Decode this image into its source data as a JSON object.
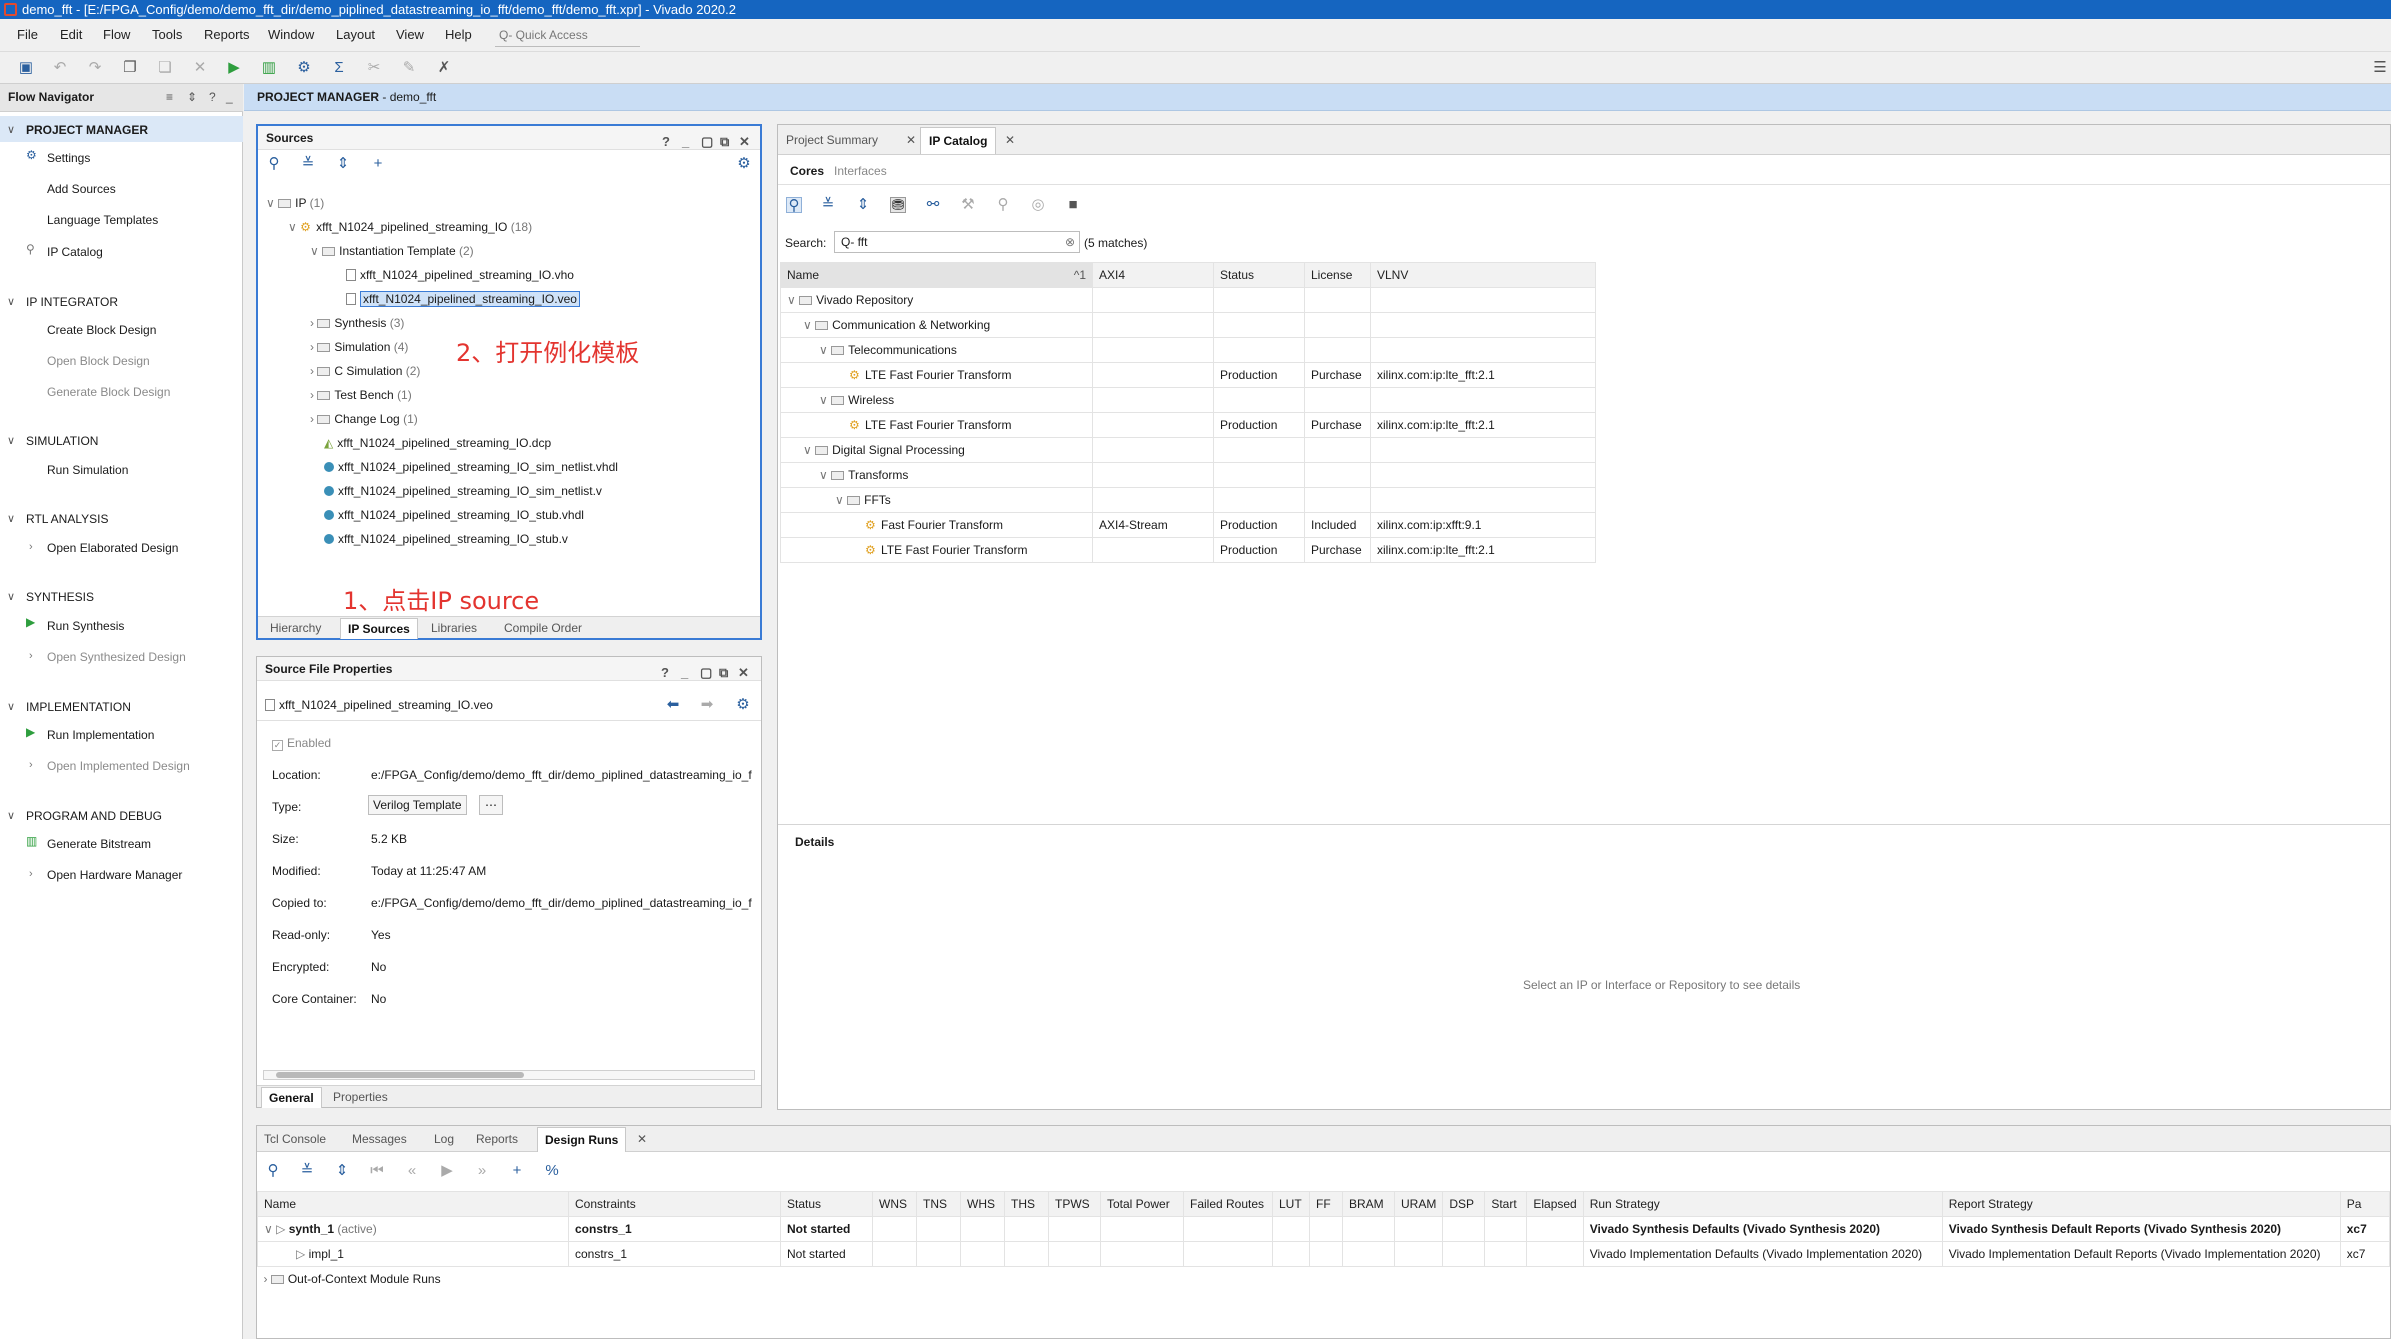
{
  "window": {
    "title": "demo_fft - [E:/FPGA_Config/demo/demo_fft_dir/demo_piplined_datastreaming_io_fft/demo_fft/demo_fft.xpr] - Vivado 2020.2"
  },
  "menu": [
    "File",
    "Edit",
    "Flow",
    "Tools",
    "Reports",
    "Window",
    "Layout",
    "View",
    "Help"
  ],
  "quick_access": "Q- Quick Access",
  "flow_navigator": {
    "title": "Flow Navigator",
    "sections": [
      {
        "label": "PROJECT MANAGER",
        "items": [
          "Settings",
          "Add Sources",
          "Language Templates",
          "IP Catalog"
        ]
      },
      {
        "label": "IP INTEGRATOR",
        "items": [
          "Create Block Design",
          "Open Block Design",
          "Generate Block Design"
        ]
      },
      {
        "label": "SIMULATION",
        "items": [
          "Run Simulation"
        ]
      },
      {
        "label": "RTL ANALYSIS",
        "items": [
          "Open Elaborated Design"
        ]
      },
      {
        "label": "SYNTHESIS",
        "items": [
          "Run Synthesis",
          "Open Synthesized Design"
        ]
      },
      {
        "label": "IMPLEMENTATION",
        "items": [
          "Run Implementation",
          "Open Implemented Design"
        ]
      },
      {
        "label": "PROGRAM AND DEBUG",
        "items": [
          "Generate Bitstream",
          "Open Hardware Manager"
        ]
      }
    ]
  },
  "project_bar": {
    "label": "PROJECT MANAGER",
    "name": "- demo_fft"
  },
  "sources": {
    "title": "Sources",
    "tree": {
      "ip": "IP",
      "ip_count": "(1)",
      "core": "xfft_N1024_pipelined_streaming_IO",
      "core_count": "(18)",
      "inst": "Instantiation Template",
      "inst_count": "(2)",
      "vho": "xfft_N1024_pipelined_streaming_IO.vho",
      "veo": "xfft_N1024_pipelined_streaming_IO.veo",
      "synthesis": "Synthesis",
      "synthesis_count": "(3)",
      "simulation": "Simulation",
      "simulation_count": "(4)",
      "csim": "C Simulation",
      "csim_count": "(2)",
      "testbench": "Test Bench",
      "testbench_count": "(1)",
      "changelog": "Change Log",
      "changelog_count": "(1)",
      "dcp": "xfft_N1024_pipelined_streaming_IO.dcp",
      "simvhdl": "xfft_N1024_pipelined_streaming_IO_sim_netlist.vhdl",
      "simv": "xfft_N1024_pipelined_streaming_IO_sim_netlist.v",
      "stubvhdl": "xfft_N1024_pipelined_streaming_IO_stub.vhdl",
      "stubv": "xfft_N1024_pipelined_streaming_IO_stub.v"
    },
    "tabs": [
      "Hierarchy",
      "IP Sources",
      "Libraries",
      "Compile Order"
    ],
    "annot1": "1、点击IP source",
    "annot2": "2、打开例化模板"
  },
  "props": {
    "title": "Source File Properties",
    "file": "xfft_N1024_pipelined_streaming_IO.veo",
    "enabled": "Enabled",
    "labels": [
      "Location:",
      "Type:",
      "Size:",
      "Modified:",
      "Copied to:",
      "Read-only:",
      "Encrypted:",
      "Core Container:"
    ],
    "location": "e:/FPGA_Config/demo/demo_fft_dir/demo_piplined_datastreaming_io_f",
    "type": "Verilog Template",
    "size": "5.2 KB",
    "modified": "Today at 11:25:47 AM",
    "copied": "e:/FPGA_Config/demo/demo_fft_dir/demo_piplined_datastreaming_io_f",
    "readonly": "Yes",
    "encrypted": "No",
    "core_container": "No",
    "tabs": [
      "General",
      "Properties"
    ]
  },
  "ipcat": {
    "tabs": [
      "Project Summary",
      "IP Catalog"
    ],
    "subtabs": [
      "Cores",
      "Interfaces"
    ],
    "search_label": "Search:",
    "search_value": "Q- fft",
    "matches": "(5 matches)",
    "columns": [
      "Name",
      "AXI4",
      "Status",
      "License",
      "VLNV"
    ],
    "rows": [
      {
        "name": "Vivado Repository",
        "axi": "",
        "status": "",
        "lic": "",
        "vlnv": ""
      },
      {
        "name": "Communication & Networking",
        "axi": "",
        "status": "",
        "lic": "",
        "vlnv": ""
      },
      {
        "name": "Telecommunications",
        "axi": "",
        "status": "",
        "lic": "",
        "vlnv": ""
      },
      {
        "name": "LTE Fast Fourier Transform",
        "axi": "",
        "status": "Production",
        "lic": "Purchase",
        "vlnv": "xilinx.com:ip:lte_fft:2.1"
      },
      {
        "name": "Wireless",
        "axi": "",
        "status": "",
        "lic": "",
        "vlnv": ""
      },
      {
        "name": "LTE Fast Fourier Transform",
        "axi": "",
        "status": "Production",
        "lic": "Purchase",
        "vlnv": "xilinx.com:ip:lte_fft:2.1"
      },
      {
        "name": "Digital Signal Processing",
        "axi": "",
        "status": "",
        "lic": "",
        "vlnv": ""
      },
      {
        "name": "Transforms",
        "axi": "",
        "status": "",
        "lic": "",
        "vlnv": ""
      },
      {
        "name": "FFTs",
        "axi": "",
        "status": "",
        "lic": "",
        "vlnv": ""
      },
      {
        "name": "Fast Fourier Transform",
        "axi": "AXI4-Stream",
        "status": "Production",
        "lic": "Included",
        "vlnv": "xilinx.com:ip:xfft:9.1"
      },
      {
        "name": "LTE Fast Fourier Transform",
        "axi": "",
        "status": "Production",
        "lic": "Purchase",
        "vlnv": "xilinx.com:ip:lte_fft:2.1"
      }
    ],
    "details_title": "Details",
    "details_text": "Select an IP or Interface or Repository to see details"
  },
  "runs": {
    "tabs": [
      "Tcl Console",
      "Messages",
      "Log",
      "Reports",
      "Design Runs"
    ],
    "columns": [
      "Name",
      "Constraints",
      "Status",
      "WNS",
      "TNS",
      "WHS",
      "THS",
      "TPWS",
      "Total Power",
      "Failed Routes",
      "LUT",
      "FF",
      "BRAM",
      "URAM",
      "DSP",
      "Start",
      "Elapsed",
      "Run Strategy",
      "Report Strategy",
      "Pa"
    ],
    "synth": {
      "name": "synth_1",
      "active": "(active)",
      "constraints": "constrs_1",
      "status": "Not started",
      "run_strategy": "Vivado Synthesis Defaults (Vivado Synthesis 2020)",
      "report_strategy": "Vivado Synthesis Default Reports (Vivado Synthesis 2020)",
      "part": "xc7"
    },
    "impl": {
      "name": "impl_1",
      "constraints": "constrs_1",
      "status": "Not started",
      "run_strategy": "Vivado Implementation Defaults (Vivado Implementation 2020)",
      "report_strategy": "Vivado Implementation Default Reports (Vivado Implementation 2020)",
      "part": "xc7"
    },
    "ooc": "Out-of-Context Module Runs"
  }
}
